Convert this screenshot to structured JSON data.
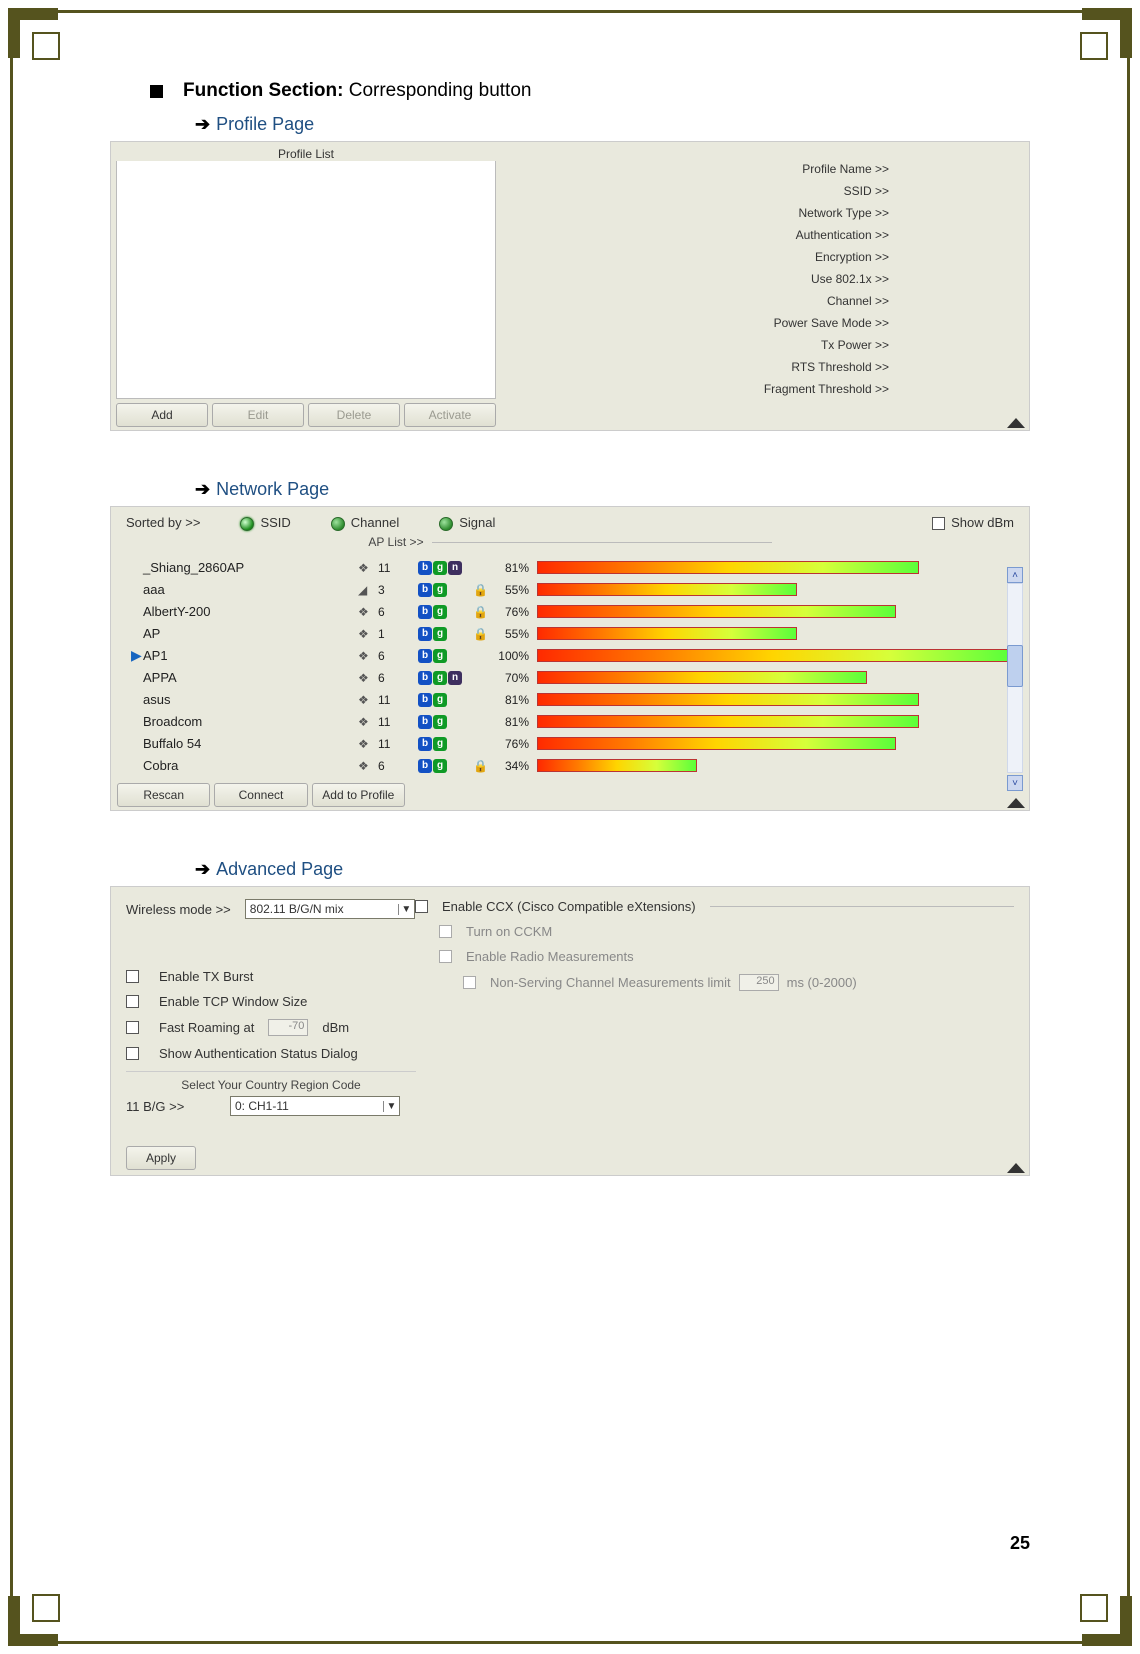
{
  "page_number": "25",
  "heading": {
    "bold": "Function Section:",
    "rest": " Corresponding button"
  },
  "arrows": {
    "profile": "Profile Page",
    "network": "Network Page",
    "advanced": "Advanced Page"
  },
  "profile_panel": {
    "list_title": "Profile List",
    "buttons": {
      "add": "Add",
      "edit": "Edit",
      "delete": "Delete",
      "activate": "Activate"
    },
    "fields": [
      "Profile Name >>",
      "SSID >>",
      "Network Type >>",
      "Authentication >>",
      "Encryption >>",
      "Use 802.1x >>",
      "Channel >>",
      "Power Save Mode >>",
      "Tx Power >>",
      "RTS Threshold >>",
      "Fragment Threshold >>"
    ]
  },
  "network_panel": {
    "sorted_by": "Sorted by >>",
    "opts": {
      "ssid": "SSID",
      "channel": "Channel",
      "signal": "Signal"
    },
    "show_dbm": "Show dBm",
    "ap_list_title": "AP List >>",
    "buttons": {
      "rescan": "Rescan",
      "connect": "Connect",
      "add_profile": "Add to Profile"
    },
    "rows": [
      {
        "name": "_Shiang_2860AP",
        "ch": "11",
        "modes": [
          "b",
          "g",
          "n"
        ],
        "lock": false,
        "pct": 81,
        "sel": false
      },
      {
        "name": "aaa",
        "ch": "3",
        "modes": [
          "b",
          "g"
        ],
        "lock": true,
        "pct": 55,
        "sel": false,
        "alt_chicon": true
      },
      {
        "name": "AlbertY-200",
        "ch": "6",
        "modes": [
          "b",
          "g"
        ],
        "lock": true,
        "pct": 76,
        "sel": false
      },
      {
        "name": "AP",
        "ch": "1",
        "modes": [
          "b",
          "g"
        ],
        "lock": true,
        "pct": 55,
        "sel": false
      },
      {
        "name": "AP1",
        "ch": "6",
        "modes": [
          "b",
          "g"
        ],
        "lock": false,
        "pct": 100,
        "sel": true
      },
      {
        "name": "APPA",
        "ch": "6",
        "modes": [
          "b",
          "g",
          "n"
        ],
        "lock": false,
        "pct": 70,
        "sel": false
      },
      {
        "name": "asus",
        "ch": "11",
        "modes": [
          "b",
          "g"
        ],
        "lock": false,
        "pct": 81,
        "sel": false
      },
      {
        "name": "Broadcom",
        "ch": "11",
        "modes": [
          "b",
          "g"
        ],
        "lock": false,
        "pct": 81,
        "sel": false
      },
      {
        "name": "Buffalo 54",
        "ch": "11",
        "modes": [
          "b",
          "g"
        ],
        "lock": false,
        "pct": 76,
        "sel": false
      },
      {
        "name": "Cobra",
        "ch": "6",
        "modes": [
          "b",
          "g"
        ],
        "lock": true,
        "pct": 34,
        "sel": false
      }
    ]
  },
  "advanced_panel": {
    "wireless_mode_label": "Wireless mode >>",
    "wireless_mode_value": "802.11 B/G/N mix",
    "enable_tx_burst": "Enable TX Burst",
    "enable_tcp_window": "Enable TCP Window Size",
    "fast_roaming_pre": "Fast Roaming at",
    "fast_roaming_val": "-70",
    "fast_roaming_post": "dBm",
    "show_auth": "Show Authentication Status Dialog",
    "region_title": "Select Your Country Region Code",
    "bg_label": "11 B/G >>",
    "bg_value": "0: CH1-11",
    "apply": "Apply",
    "ccx_title": "Enable CCX (Cisco Compatible eXtensions)",
    "ccx_turn_on": "Turn on CCKM",
    "ccx_radio": "Enable Radio Measurements",
    "ccx_nonserving": "Non-Serving Channel Measurements limit",
    "ccx_ms_val": "250",
    "ccx_ms_post": "ms (0-2000)"
  }
}
